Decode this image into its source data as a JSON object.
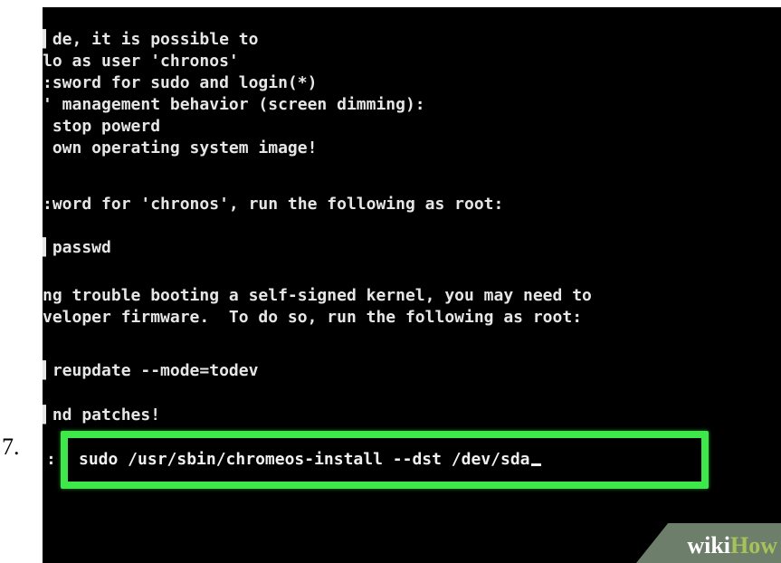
{
  "step": {
    "number": "7."
  },
  "terminal": {
    "lines": [
      "▍de, it is possible to",
      "lo as user 'chronos'",
      ":sword for sudo and login(*)",
      "' management behavior (screen dimming):",
      " stop powerd",
      " own operating system image!",
      "",
      ":word for 'chronos', run the following as root:",
      "",
      "▍passwd",
      "",
      "ng trouble booting a self-signed kernel, you may need to",
      "veloper firmware.  To do so, run the following as root:",
      "",
      "▍reupdate --mode=todev",
      "",
      "▍nd patches!"
    ],
    "prompt": ":",
    "command": "sudo /usr/sbin/chromeos-install --dst /dev/sda"
  },
  "watermark": {
    "wiki": "wiki",
    "how": "How"
  },
  "colors": {
    "highlight": "#3ee84a",
    "terminal_bg": "#000000",
    "terminal_text": "#e6e6e6",
    "watermark_bg": "#6d7f6a",
    "watermark_how": "#a8c25a"
  }
}
